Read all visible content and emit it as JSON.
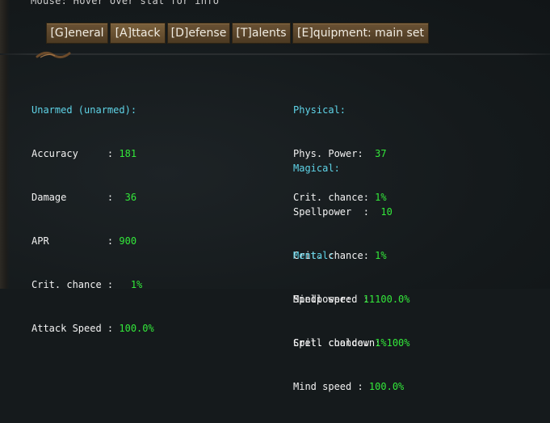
{
  "hint_text": "Mouse: Hover over stat for info",
  "tabs": [
    {
      "label": "[G]eneral"
    },
    {
      "label": "[A]ttack"
    },
    {
      "label": "[D]efense"
    },
    {
      "label": "[T]alents"
    },
    {
      "label": "[E]quipment: main set"
    }
  ],
  "active_tab": "[A]ttack",
  "left": {
    "header": "Unarmed (unarmed):",
    "rows": [
      {
        "label": "Accuracy     : ",
        "value": "181"
      },
      {
        "label": "Damage       : ",
        "value": " 36"
      },
      {
        "label": "APR          : ",
        "value": "900"
      },
      {
        "label": "Crit. chance :   ",
        "value": "1%"
      },
      {
        "label": "Attack Speed : ",
        "value": "100.0%"
      }
    ]
  },
  "physical": {
    "header": "Physical:",
    "rows": [
      {
        "label": "Phys. Power:  ",
        "value": "37"
      },
      {
        "label": "Crit. chance: ",
        "value": "1%"
      }
    ]
  },
  "magical": {
    "header": "Magical:",
    "rows": [
      {
        "label": "Spellpower  :  ",
        "value": "10"
      },
      {
        "label": "Crit. chance: ",
        "value": "1%"
      },
      {
        "label": "Spell speed : ",
        "value": "100.0%"
      },
      {
        "label": "Spell cooldown: ",
        "value": "100%"
      }
    ]
  },
  "mental": {
    "header": "Mental:",
    "rows": [
      {
        "label": "Mindpower:  ",
        "value": "11"
      },
      {
        "label": "Crit. chance: ",
        "value": "1%"
      },
      {
        "label": "Mind speed : ",
        "value": "100.0%"
      }
    ]
  },
  "colors": {
    "header": "#5fd4e8",
    "label": "#f2f2f2",
    "value": "#33e83a",
    "tab_bg": "#5a4428",
    "background": "#151a1c"
  }
}
